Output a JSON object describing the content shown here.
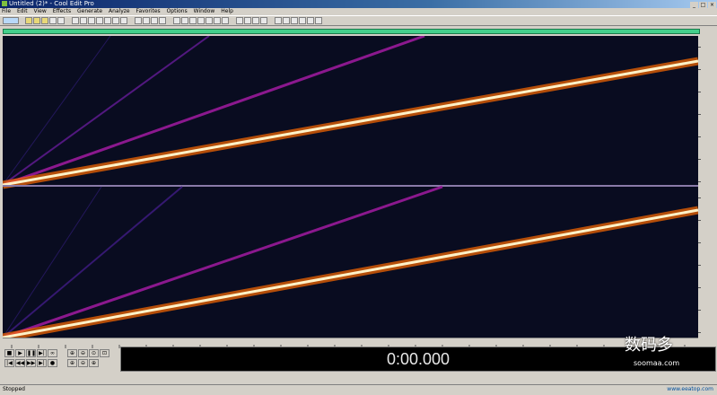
{
  "window": {
    "title": "Untitled (2)* - Cool Edit Pro"
  },
  "menu": [
    "File",
    "Edit",
    "View",
    "Effects",
    "Generate",
    "Analyze",
    "Favorites",
    "Options",
    "Window",
    "Help"
  ],
  "time_display": "0:00.000",
  "status": "Stopped",
  "watermark": {
    "text": "数码多",
    "url": "soomaa.com"
  },
  "footer_url": "www.eeatop.com"
}
